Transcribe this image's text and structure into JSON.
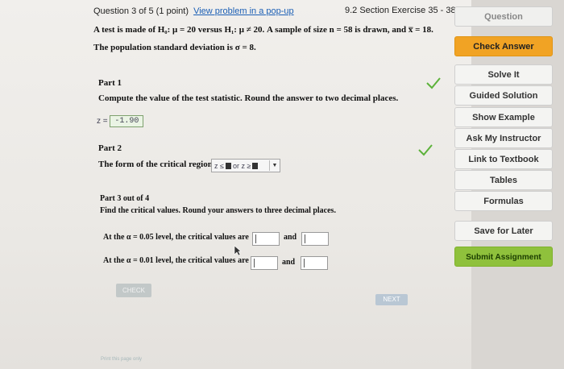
{
  "header": {
    "question": "Question 3 of 5 (1 point)",
    "popup_link": "View problem in a pop-up",
    "section": "9.2 Section Exercise 35 - 38"
  },
  "problem": {
    "line1": "A test is made of H₀: μ = 20 versus H₁: μ ≠ 20. A sample of size n = 58 is drawn, and x̅ = 18.",
    "line2": "The population standard deviation is σ = 8."
  },
  "part1": {
    "title": "Part 1",
    "instruction": "Compute the value of the test statistic. Round the answer to two decimal places.",
    "z_label": "z =",
    "z_value": "-1.90"
  },
  "part2": {
    "title": "Part 2",
    "instruction": "The form of the critical region is",
    "dd_left": "z ≤",
    "dd_or": "or z ≥"
  },
  "part3": {
    "title": "Part 3 out of 4",
    "instruction": "Find the critical values. Round your answers to three decimal places.",
    "row1": "At the α = 0.05 level, the critical values are",
    "row2": "At the α = 0.01 level, the critical values are",
    "and": "and"
  },
  "buttons": {
    "check": "CHECK",
    "next": "NEXT"
  },
  "footer": "Print this page only",
  "sidebar": {
    "question": "Question",
    "check_answer": "Check Answer",
    "solve_it": "Solve It",
    "guided_solution": "Guided Solution",
    "show_example": "Show Example",
    "ask_instructor": "Ask My Instructor",
    "link_textbook": "Link to Textbook",
    "tables": "Tables",
    "formulas": "Formulas",
    "save_later": "Save for Later",
    "submit_assignment": "Submit Assignment"
  },
  "colors": {
    "accent_orange": "#f1a324",
    "accent_green": "#8fc13c",
    "check_green": "#5cb23a",
    "link_blue": "#1b5fb5"
  }
}
